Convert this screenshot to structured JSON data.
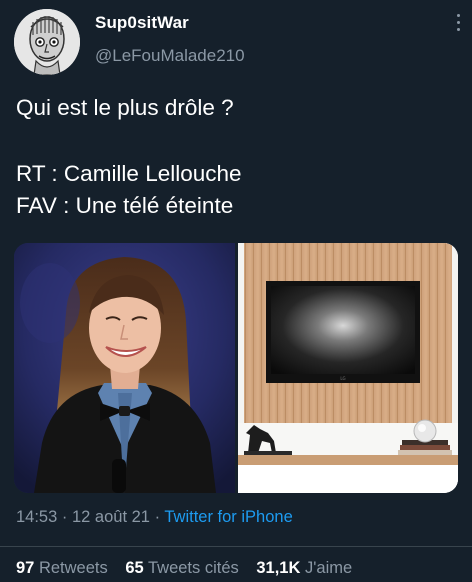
{
  "author": {
    "display_name": "Sup0sitWar",
    "handle": "@LeFouMalade210"
  },
  "tweet": {
    "lines": [
      "Qui est le plus drôle ?",
      "",
      "RT : Camille Lellouche",
      "FAV : Une télé éteinte"
    ]
  },
  "media": {
    "left_image": "portrait of a smiling woman with long hair, denim shirt and black bow tie on a blue-purple stage background",
    "right_image": "switched-off flat-screen television mounted on a light wood panel above a white shelf with a small horse figurine, books and a glass ornament"
  },
  "meta": {
    "time": "14:53",
    "separator1": "·",
    "date": "12 août 21",
    "separator2": "·",
    "source": "Twitter for iPhone"
  },
  "stats": {
    "retweets_count": "97",
    "retweets_label": "Retweets",
    "quotes_count": "65",
    "quotes_label": "Tweets cités",
    "likes_count": "31,1K",
    "likes_label": "J'aime"
  },
  "colors": {
    "background": "#15202b",
    "secondary_text": "#8b98a5",
    "link": "#1d9bf0",
    "divider": "#38444d"
  }
}
